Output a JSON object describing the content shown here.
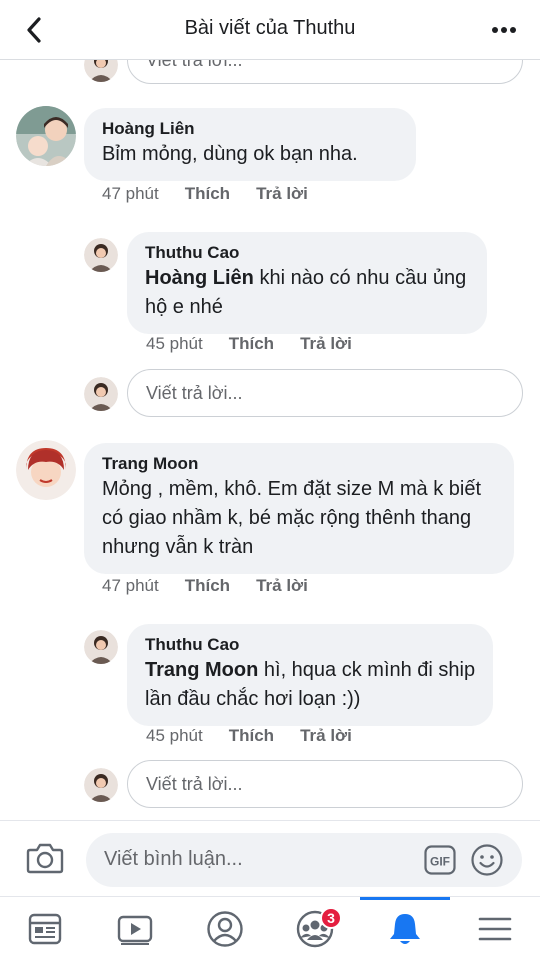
{
  "header": {
    "title": "Bài viết của Thuthu"
  },
  "top_partial": {
    "placeholder": "Viết trả lời..."
  },
  "comments": [
    {
      "author": "Hoàng Liên",
      "text": "Bỉm mỏng, dùng ok bạn nha.",
      "time": "47 phút",
      "like": "Thích",
      "reply": "Trả lời",
      "avatar_color": "#c9a98a",
      "reply_item": {
        "author": "Thuthu Cao",
        "mention": "Hoàng Liên",
        "text": " khi nào có nhu cầu ủng hộ e nhé",
        "time": "45 phút",
        "like": "Thích",
        "reply": "Trả lời"
      },
      "reply_placeholder": "Viết trả lời..."
    },
    {
      "author": "Trang Moon",
      "text": "Mỏng , mềm, khô. Em đặt size M mà k biết có giao nhầm k, bé mặc rộng thênh thang nhưng vẫn k tràn",
      "time": "47 phút",
      "like": "Thích",
      "reply": "Trả lời",
      "avatar_color": "#e8b39a",
      "reply_item": {
        "author": "Thuthu Cao",
        "mention": "Trang Moon",
        "text": " hì, hqua ck mình đi ship lần đầu chắc hơi loạn :))",
        "time": "45 phút",
        "like": "Thích",
        "reply": "Trả lời"
      },
      "reply_placeholder": "Viết trả lời..."
    }
  ],
  "composer": {
    "placeholder": "Viết bình luận...",
    "gif_label": "GIF"
  },
  "tabbar": {
    "groups_badge": "3",
    "accent_color": "#1877f2",
    "items": [
      "news-feed-icon",
      "watch-icon",
      "profile-icon",
      "groups-icon",
      "notifications-icon",
      "menu-icon"
    ]
  }
}
